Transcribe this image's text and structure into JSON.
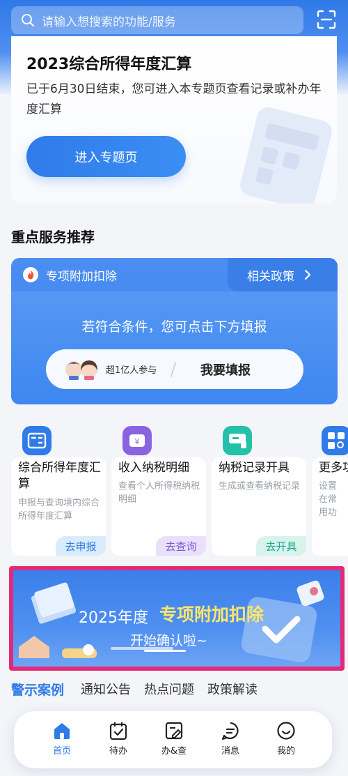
{
  "search": {
    "placeholder": "请输入想搜索的功能/服务"
  },
  "tax_card": {
    "title": "2023综合所得年度汇算",
    "desc": "已于6月30日结束，您可进入本专题页查看记录或补办年度汇算",
    "button": "进入专题页"
  },
  "section_title": "重点服务推荐",
  "deduction": {
    "label": "专项附加扣除",
    "policy": "相关政策",
    "hint": "若符合条件，您可点击下方填报",
    "participants": "超1亿人参与",
    "fill": "我要填报"
  },
  "services": [
    {
      "name": "综合所得年度汇算",
      "sub": "申报与查询境内综合所得年度汇算",
      "tag": "去申报"
    },
    {
      "name": "收入纳税明细",
      "sub": "查看个人所得税纳税明细",
      "tag": "去查询"
    },
    {
      "name": "纳税记录开具",
      "sub": "生成或查看纳税记录",
      "tag": "去开具"
    },
    {
      "name": "更多功",
      "sub": "设置在常用功"
    }
  ],
  "banner": {
    "year": "2025年度",
    "highlight": "专项附加扣除",
    "sub": "开始确认啦~"
  },
  "tabs": [
    "警示案例",
    "通知公告",
    "热点问题",
    "政策解读"
  ],
  "nav": [
    {
      "label": "首页",
      "icon": "home-icon"
    },
    {
      "label": "待办",
      "icon": "calendar-check-icon"
    },
    {
      "label": "办&查",
      "icon": "edit-doc-icon"
    },
    {
      "label": "消息",
      "icon": "message-icon"
    },
    {
      "label": "我的",
      "icon": "smile-icon"
    }
  ],
  "colors": {
    "accent": "#2f7be8",
    "highlight_border": "#e22a78",
    "banner_highlight": "#ffe56b"
  }
}
